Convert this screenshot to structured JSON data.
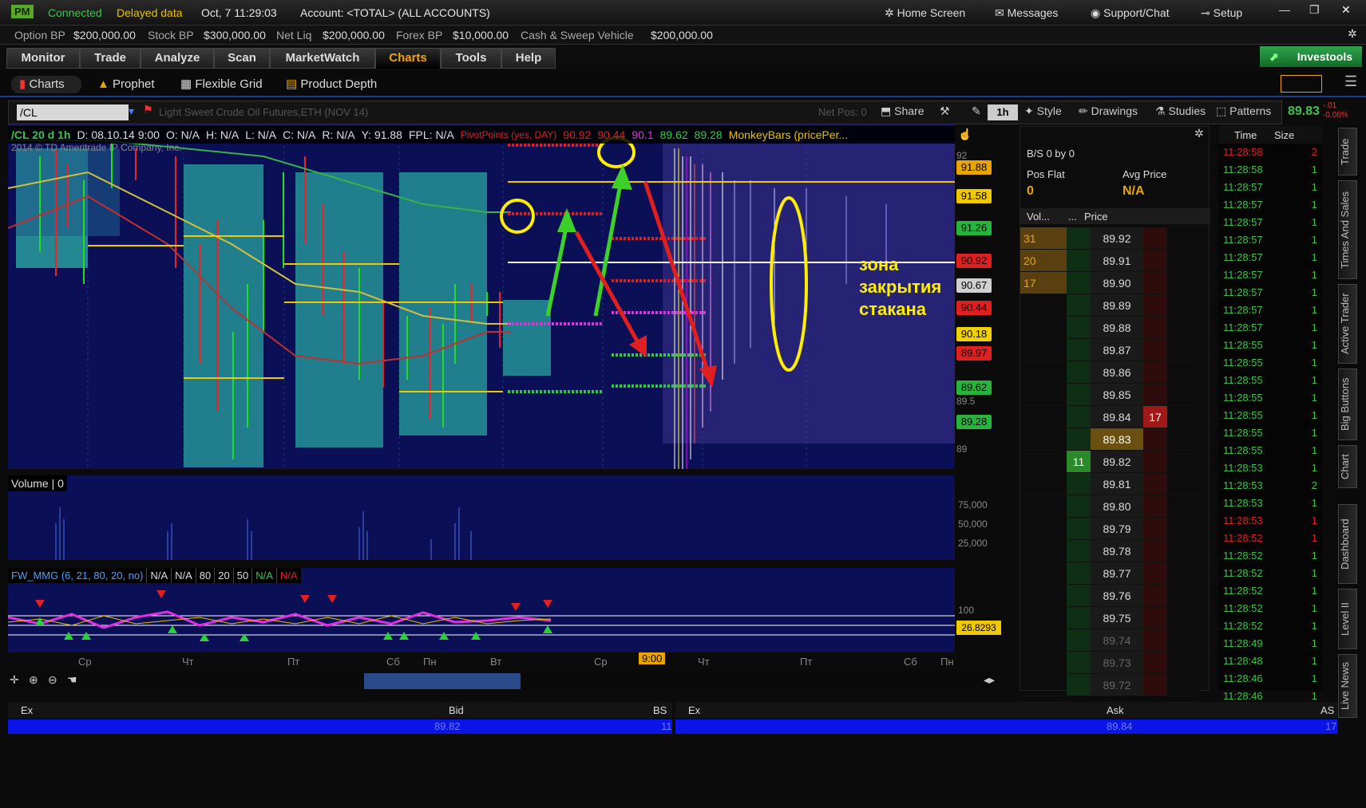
{
  "topbar": {
    "badge": "PM",
    "connected": "Connected",
    "delayed": "Delayed data",
    "datetime": "Oct, 7  11:29:03",
    "account": "Account: <TOTAL> (ALL ACCOUNTS)",
    "home": "Home Screen",
    "messages": "Messages",
    "support": "Support/Chat",
    "setup": "Setup"
  },
  "bp": [
    {
      "label": "Option BP",
      "value": "$200,000.00"
    },
    {
      "label": "Stock BP",
      "value": "$300,000.00"
    },
    {
      "label": "Net Liq",
      "value": "$200,000.00"
    },
    {
      "label": "Forex BP",
      "value": "$10,000.00"
    },
    {
      "label": "Cash & Sweep Vehicle",
      "value": "$200,000.00"
    }
  ],
  "tabs": [
    "Monitor",
    "Trade",
    "Analyze",
    "Scan",
    "MarketWatch",
    "Charts",
    "Tools",
    "Help"
  ],
  "active_tab": "Charts",
  "investools": "Investools",
  "subtabs": [
    "Charts",
    "Prophet",
    "Flexible Grid",
    "Product Depth"
  ],
  "chart_header": {
    "symbol": "/CL",
    "description": "Light Sweet Crude Oil Futures,ETH (NOV 14)",
    "netpos": "Net Pos: 0",
    "share": "Share",
    "period": "1h",
    "style": "Style",
    "drawings": "Drawings",
    "studies": "Studies",
    "patterns": "Patterns",
    "last": "89.83",
    "change1": "-.01",
    "change2": "-0.06%"
  },
  "ohlc": {
    "sym": "/CL 20 d 1h",
    "d": "D: 08.10.14 9:00",
    "o": "O: N/A",
    "h": "H: N/A",
    "l": "L: N/A",
    "c": "C: N/A",
    "r": "R: N/A",
    "y": "Y: 91.88",
    "fpl": "FPL: N/A",
    "pivot": "PivotPoints (yes, DAY)",
    "p1": "90.92",
    "p2": "90.44",
    "p3": "90.1",
    "p4": "89.62",
    "p5": "89.28",
    "monkey": "MonkeyBars (pricePer..."
  },
  "copyright": "2014 © TD Ameritrade IP Company, Inc.",
  "annotation": {
    "line1": "зона",
    "line2": "закрытия",
    "line3": "стакана"
  },
  "price_tags": [
    {
      "label": "91.88",
      "color": "#e8a400"
    },
    {
      "label": "91.58",
      "color": "#f0c800"
    },
    {
      "label": "91.26",
      "color": "#28b43c"
    },
    {
      "label": "90.92",
      "color": "#e0201e"
    },
    {
      "label": "90.67",
      "color": "#d0d0d0"
    },
    {
      "label": "90.44",
      "color": "#e0201e"
    },
    {
      "label": "90.18",
      "color": "#f0d000"
    },
    {
      "label": "89.97",
      "color": "#e0201e"
    },
    {
      "label": "89.62",
      "color": "#28b43c"
    },
    {
      "label": "89.28",
      "color": "#28b43c"
    }
  ],
  "axis_labels": {
    "y92": "92",
    "y895": "89.5",
    "y89": "89"
  },
  "volume": {
    "label": "Volume",
    "value": "0",
    "ticks": [
      "75,000",
      "50,000",
      "25,000"
    ]
  },
  "indicator": {
    "label": "FW_MMG (6, 21, 80, 20, no)",
    "vals": [
      "N/A",
      "N/A",
      "80",
      "20",
      "50",
      "N/A",
      "N/A"
    ],
    "axis": "100",
    "tag": "26.8293"
  },
  "xaxis": [
    "Ср",
    "Чт",
    "Пт",
    "Сб",
    "Пн",
    "Вт",
    "Ср",
    "9:00",
    "Чт",
    "Пт",
    "Сб",
    "Пн"
  ],
  "dom": {
    "bs": "B/S 0 by 0",
    "posflat": "Pos Flat",
    "posval": "0",
    "avgprice": "Avg Price",
    "avgval": "N/A",
    "hdr_vol": "Vol...",
    "hdr_dots": "...",
    "hdr_price": "Price",
    "rows": [
      {
        "vol": "31",
        "bid": "",
        "price": "89.92",
        "ask": ""
      },
      {
        "vol": "20",
        "bid": "",
        "price": "89.91",
        "ask": ""
      },
      {
        "vol": "17",
        "bid": "",
        "price": "89.90",
        "ask": ""
      },
      {
        "vol": "",
        "bid": "",
        "price": "89.89",
        "ask": ""
      },
      {
        "vol": "",
        "bid": "",
        "price": "89.88",
        "ask": ""
      },
      {
        "vol": "",
        "bid": "",
        "price": "89.87",
        "ask": ""
      },
      {
        "vol": "",
        "bid": "",
        "price": "89.86",
        "ask": ""
      },
      {
        "vol": "",
        "bid": "",
        "price": "89.85",
        "ask": ""
      },
      {
        "vol": "",
        "bid": "",
        "price": "89.84",
        "ask": "17"
      },
      {
        "vol": "",
        "bid": "",
        "price": "89.83",
        "ask": ""
      },
      {
        "vol": "",
        "bid": "11",
        "price": "89.82",
        "ask": ""
      },
      {
        "vol": "",
        "bid": "",
        "price": "89.81",
        "ask": ""
      },
      {
        "vol": "",
        "bid": "",
        "price": "89.80",
        "ask": ""
      },
      {
        "vol": "",
        "bid": "",
        "price": "89.79",
        "ask": ""
      },
      {
        "vol": "",
        "bid": "",
        "price": "89.78",
        "ask": ""
      },
      {
        "vol": "",
        "bid": "",
        "price": "89.77",
        "ask": ""
      },
      {
        "vol": "",
        "bid": "",
        "price": "89.76",
        "ask": ""
      },
      {
        "vol": "",
        "bid": "",
        "price": "89.75",
        "ask": ""
      },
      {
        "vol": "",
        "bid": "",
        "price": "89.74",
        "ask": ""
      },
      {
        "vol": "",
        "bid": "",
        "price": "89.73",
        "ask": ""
      },
      {
        "vol": "",
        "bid": "",
        "price": "89.72",
        "ask": ""
      }
    ]
  },
  "tns": {
    "hdr_time": "Time",
    "hdr_size": "Size",
    "rows": [
      {
        "t": "11:28:58",
        "s": "2",
        "c": "red"
      },
      {
        "t": "11:28:58",
        "s": "1",
        "c": "green"
      },
      {
        "t": "11:28:57",
        "s": "1",
        "c": "green"
      },
      {
        "t": "11:28:57",
        "s": "1",
        "c": "green"
      },
      {
        "t": "11:28:57",
        "s": "1",
        "c": "green"
      },
      {
        "t": "11:28:57",
        "s": "1",
        "c": "green"
      },
      {
        "t": "11:28:57",
        "s": "1",
        "c": "green"
      },
      {
        "t": "11:28:57",
        "s": "1",
        "c": "green"
      },
      {
        "t": "11:28:57",
        "s": "1",
        "c": "green"
      },
      {
        "t": "11:28:57",
        "s": "1",
        "c": "green"
      },
      {
        "t": "11:28:57",
        "s": "1",
        "c": "green"
      },
      {
        "t": "11:28:55",
        "s": "1",
        "c": "green"
      },
      {
        "t": "11:28:55",
        "s": "1",
        "c": "green"
      },
      {
        "t": "11:28:55",
        "s": "1",
        "c": "green"
      },
      {
        "t": "11:28:55",
        "s": "1",
        "c": "green"
      },
      {
        "t": "11:28:55",
        "s": "1",
        "c": "green"
      },
      {
        "t": "11:28:55",
        "s": "1",
        "c": "green"
      },
      {
        "t": "11:28:55",
        "s": "1",
        "c": "green"
      },
      {
        "t": "11:28:53",
        "s": "1",
        "c": "green"
      },
      {
        "t": "11:28:53",
        "s": "2",
        "c": "green"
      },
      {
        "t": "11:28:53",
        "s": "1",
        "c": "green"
      },
      {
        "t": "11:28:53",
        "s": "1",
        "c": "red"
      },
      {
        "t": "11:28:52",
        "s": "1",
        "c": "red"
      },
      {
        "t": "11:28:52",
        "s": "1",
        "c": "green"
      },
      {
        "t": "11:28:52",
        "s": "1",
        "c": "green"
      },
      {
        "t": "11:28:52",
        "s": "1",
        "c": "green"
      },
      {
        "t": "11:28:52",
        "s": "1",
        "c": "green"
      },
      {
        "t": "11:28:52",
        "s": "1",
        "c": "green"
      },
      {
        "t": "11:28:49",
        "s": "1",
        "c": "green"
      },
      {
        "t": "11:28:48",
        "s": "1",
        "c": "green"
      },
      {
        "t": "11:28:46",
        "s": "1",
        "c": "green"
      },
      {
        "t": "11:28:46",
        "s": "1",
        "c": "green"
      }
    ]
  },
  "side_tabs": [
    "Trade",
    "Times And Sales",
    "Active Trader",
    "Big Buttons",
    "Chart",
    "Dashboard",
    "Level II",
    "Live News"
  ],
  "bidask": {
    "ex": "Ex",
    "bid": "Bid",
    "bs": "BS",
    "ask": "Ask",
    "as": "AS",
    "bid_val": "89.82",
    "bs_val": "11",
    "ask_val": "89.84",
    "as_val": "17"
  }
}
